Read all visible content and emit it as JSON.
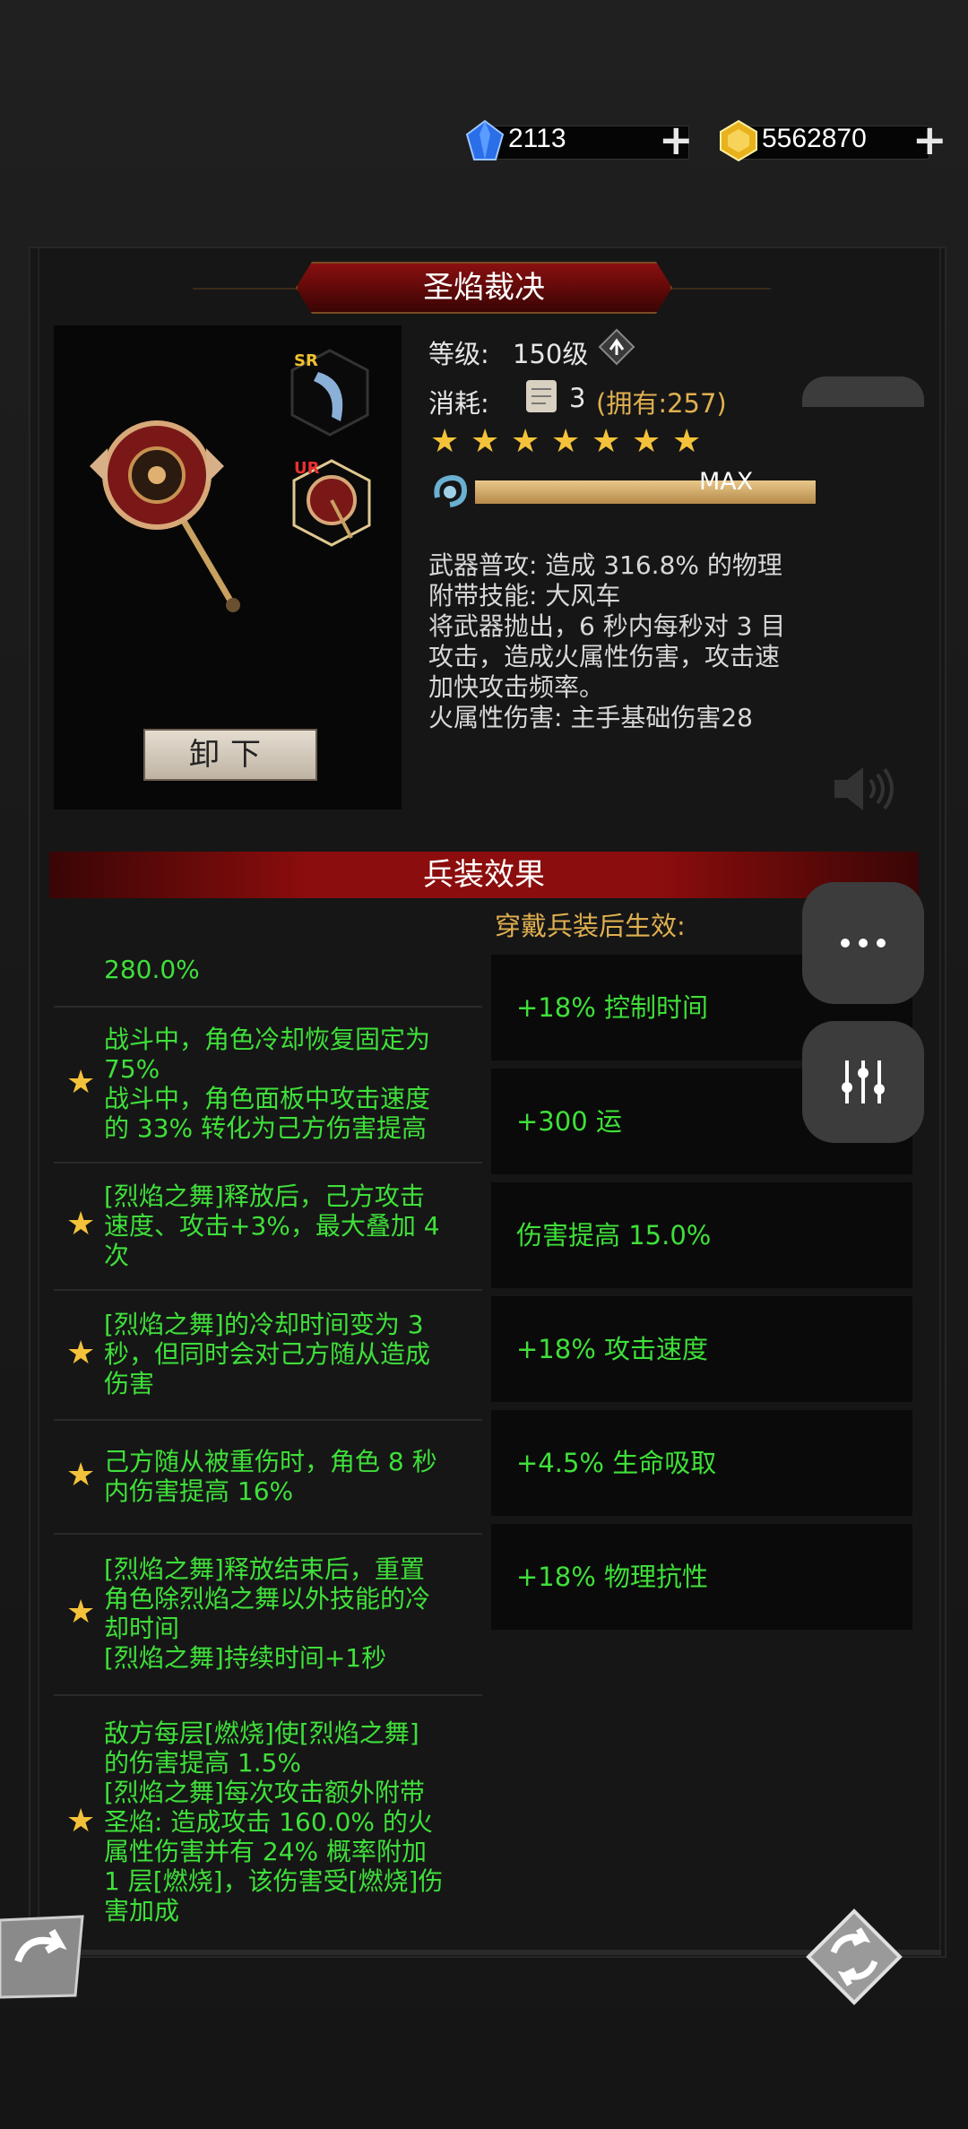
{
  "currency": {
    "diamonds": "2113",
    "gold": "5562870",
    "add": "+"
  },
  "item": {
    "name": "圣焰裁决",
    "level_label": "等级:",
    "level_value": "150级",
    "cost_label": "消耗:",
    "cost_count": "3",
    "cost_owned": "(拥有:257)",
    "stars": 7,
    "max_label": "MAX",
    "badge_sr": "SR",
    "badge_ur": "UR",
    "unequip": "卸下",
    "description": "武器普攻: 造成 316.8% 的物理\n附带技能: 大风车\n将武器抛出，6 秒内每秒对 3 目\n攻击，造成火属性伤害，攻击速\n加快攻击频率。\n火属性伤害: 主手基础伤害28"
  },
  "effects": {
    "title": "兵装效果",
    "wear_label": "穿戴兵装后生效:",
    "rows": [
      {
        "text": "280.0%",
        "star": false
      },
      {
        "text": "战斗中，角色冷却恢复固定为\n75%\n战斗中，角色面板中攻击速度\n的 33% 转化为己方伤害提高",
        "star": true
      },
      {
        "text": "[烈焰之舞]释放后，己方攻击\n速度、攻击+3%，最大叠加 4\n次",
        "star": true
      },
      {
        "text": "[烈焰之舞]的冷却时间变为 3\n秒，但同时会对己方随从造成\n伤害",
        "star": true
      },
      {
        "text": "己方随从被重伤时，角色 8 秒\n内伤害提高 16%",
        "star": true
      },
      {
        "text": "[烈焰之舞]释放结束后，重置\n角色除烈焰之舞以外技能的冷\n却时间\n[烈焰之舞]持续时间+1秒",
        "star": true
      },
      {
        "text": "敌方每层[燃烧]使[烈焰之舞]\n的伤害提高 1.5%\n[烈焰之舞]每次攻击额外附带\n圣焰: 造成攻击 160.0% 的火\n属性伤害并有 24% 概率附加\n1 层[燃烧]，该伤害受[燃烧]伤\n害加成",
        "star": true
      }
    ],
    "bonuses": [
      "+18% 控制时间",
      "+300 运",
      "伤害提高 15.0%",
      "+18% 攻击速度",
      "+4.5% 生命吸取",
      "+18% 物理抗性"
    ]
  },
  "icons": {
    "diamond": "diamond-icon",
    "gold": "gold-icon",
    "scroll": "scroll-icon",
    "level_up": "level-up-icon",
    "volume": "volume-icon",
    "more": "more-icon",
    "equalizer": "equalizer-icon",
    "back": "back-arrow-icon",
    "swap": "swap-icon"
  },
  "colors": {
    "green": "#3fe03a",
    "gold": "#e0b050",
    "star": "#f4c23a",
    "red_banner": "#8c0d0d"
  }
}
